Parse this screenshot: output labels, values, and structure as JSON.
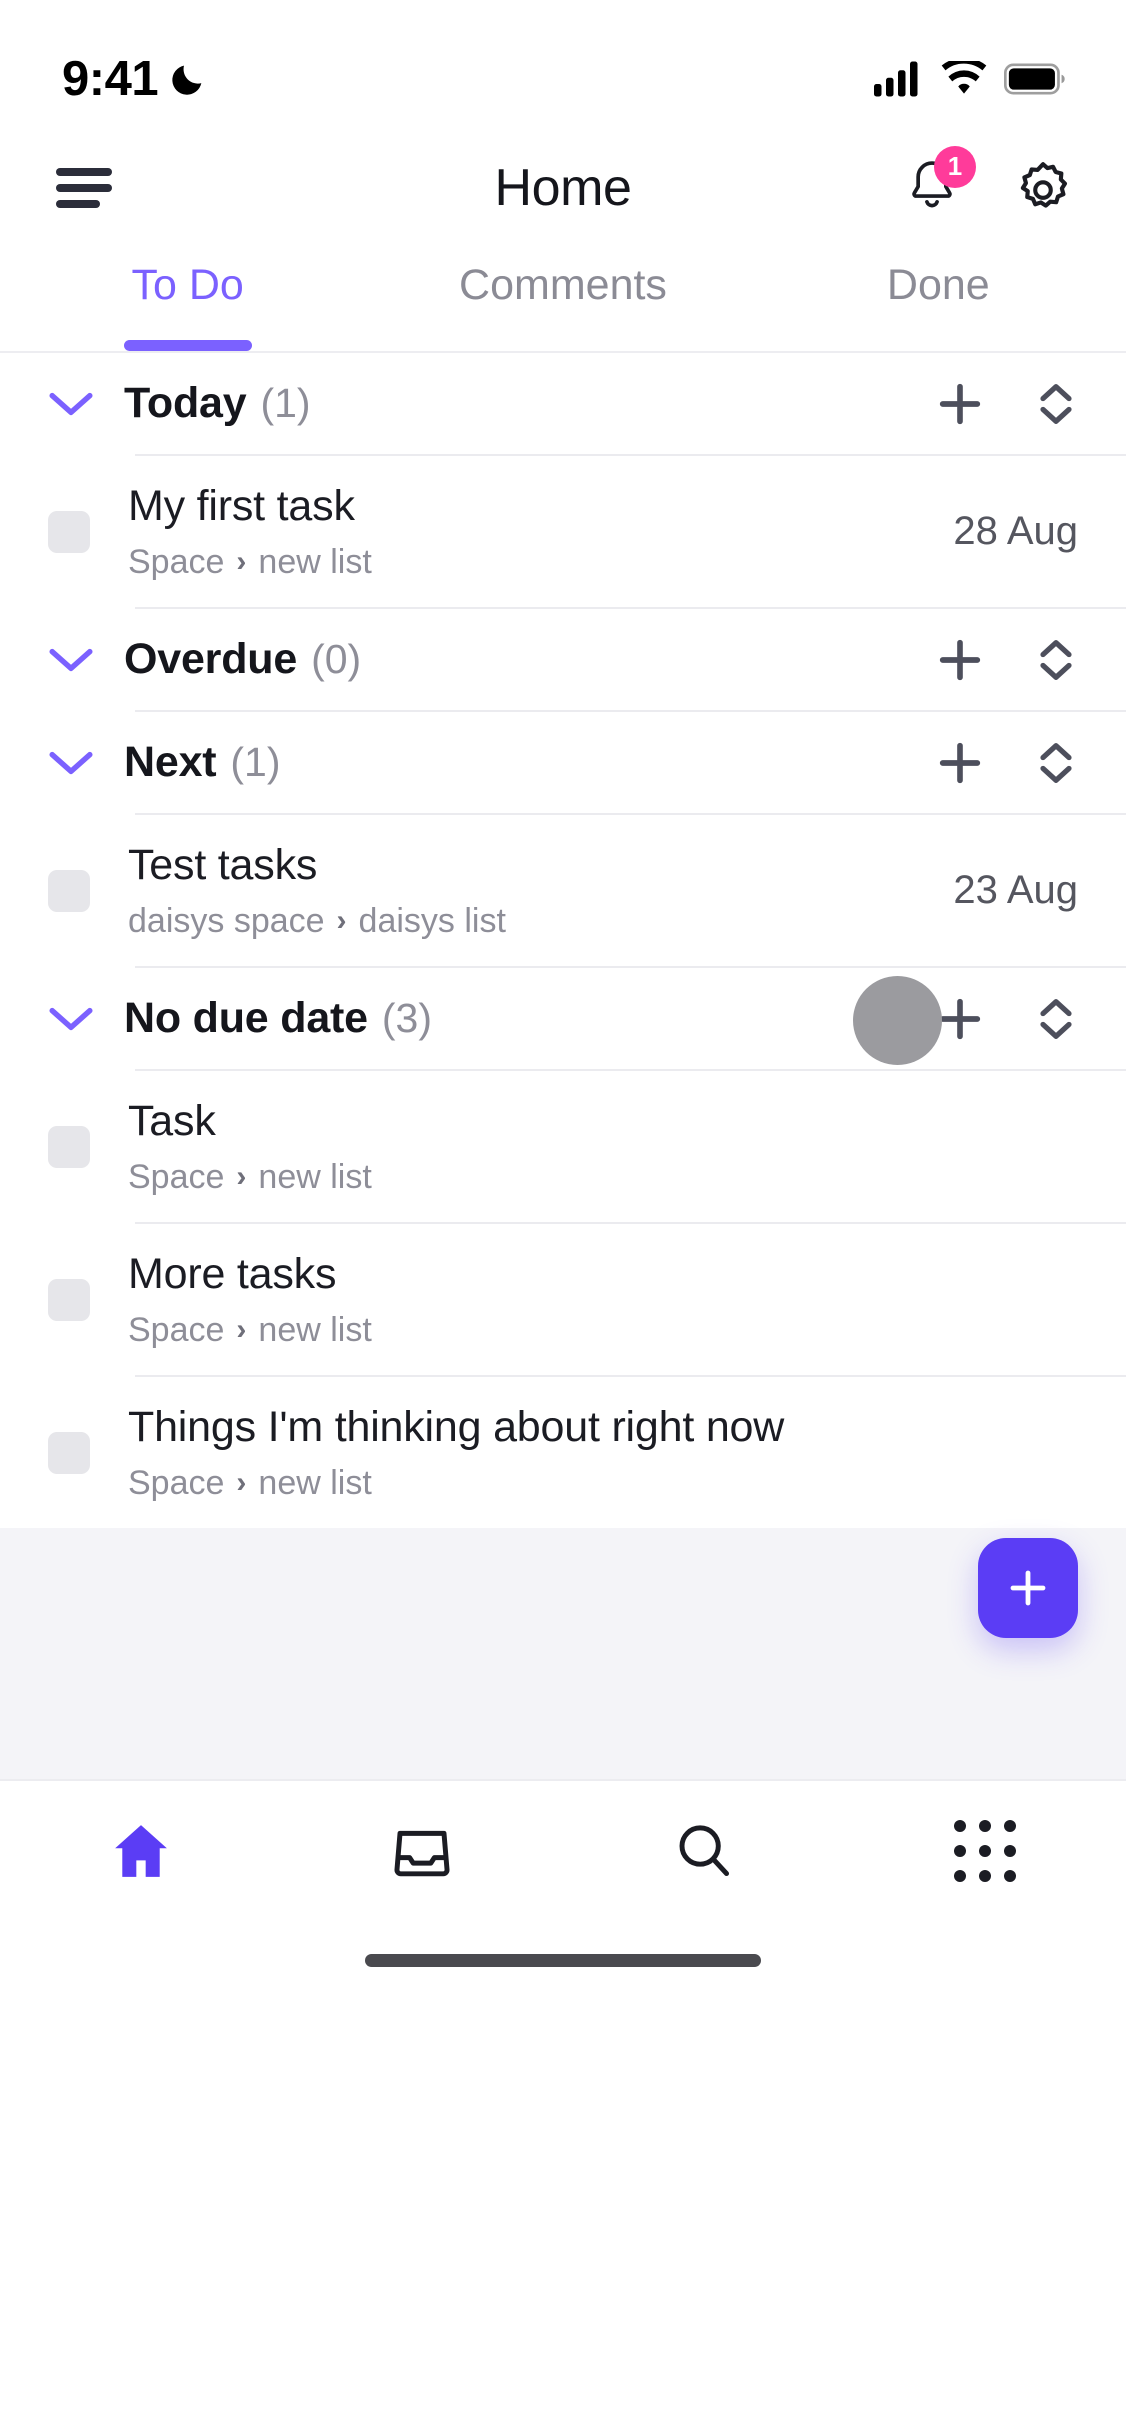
{
  "status_bar": {
    "time": "9:41",
    "dnd_icon": "moon-icon",
    "cellular_icon": "cellular-signal-icon",
    "wifi_icon": "wifi-icon",
    "battery_icon": "battery-full-icon"
  },
  "header": {
    "menu_icon": "hamburger-menu-icon",
    "title": "Home",
    "notifications_icon": "bell-icon",
    "notifications_badge": "1",
    "settings_icon": "gear-icon"
  },
  "tabs": [
    {
      "label": "To Do",
      "active": true
    },
    {
      "label": "Comments",
      "active": false
    },
    {
      "label": "Done",
      "active": false
    }
  ],
  "colors": {
    "accent_purple": "#7B61FF",
    "fab_purple": "#5B3DF5",
    "badge_pink": "#FF3B9A",
    "muted_text": "#8E8E98",
    "empty_bg": "#F4F4F8",
    "touch_circle": "#9B9B9F"
  },
  "section_icons": {
    "collapse_icon": "chevron-down-icon",
    "add_icon": "plus-icon",
    "sort_icon": "chevron-up-down-sort-icon",
    "checkbox_icon": "task-checkbox-icon",
    "breadcrumb_separator": "›"
  },
  "sections": [
    {
      "title": "Today",
      "count": "(1)",
      "tasks": [
        {
          "title": "My first task",
          "space": "Space",
          "list": "new list",
          "date": "28 Aug"
        }
      ]
    },
    {
      "title": "Overdue",
      "count": "(0)",
      "tasks": []
    },
    {
      "title": "Next",
      "count": "(1)",
      "tasks": [
        {
          "title": "Test tasks",
          "space": "daisys space",
          "list": "daisys list",
          "date": "23 Aug"
        }
      ]
    },
    {
      "title": "No due date",
      "count": "(3)",
      "tasks": [
        {
          "title": "Task",
          "space": "Space",
          "list": "new list",
          "date": ""
        },
        {
          "title": "More tasks",
          "space": "Space",
          "list": "new list",
          "date": ""
        },
        {
          "title": "Things I'm thinking about right now",
          "space": "Space",
          "list": "new list",
          "date": ""
        }
      ]
    }
  ],
  "fab": {
    "icon": "plus-icon",
    "label": "+"
  },
  "bottom_nav": [
    {
      "icon": "home-icon",
      "active": true
    },
    {
      "icon": "inbox-tray-icon",
      "active": false
    },
    {
      "icon": "search-icon",
      "active": false
    },
    {
      "icon": "apps-grid-icon",
      "active": false
    }
  ]
}
